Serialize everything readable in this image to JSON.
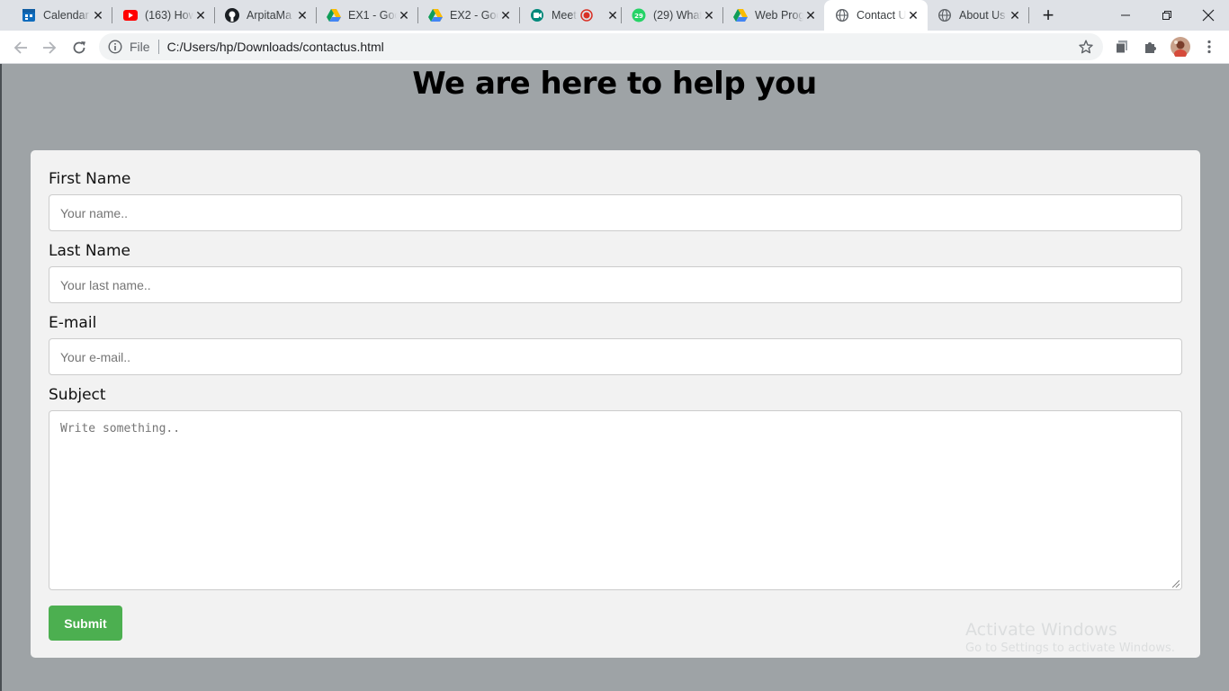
{
  "browser": {
    "tabs": [
      {
        "title": "Calendar",
        "icon": "calendar-icon",
        "active": false
      },
      {
        "title": "(163) How",
        "icon": "youtube-icon",
        "active": false
      },
      {
        "title": "ArpitaMa",
        "icon": "github-icon",
        "active": false
      },
      {
        "title": "EX1 - Goo",
        "icon": "google-drive-icon",
        "active": false
      },
      {
        "title": "EX2 - Goo",
        "icon": "google-drive-icon",
        "active": false
      },
      {
        "title": "Meet",
        "icon": "google-meet-icon",
        "active": false
      },
      {
        "title": "(29) What",
        "icon": "whatsapp-icon",
        "active": false
      },
      {
        "title": "Web Prog",
        "icon": "google-drive-icon",
        "active": false
      },
      {
        "title": "Contact U",
        "icon": "globe-icon",
        "active": true
      },
      {
        "title": "About Us",
        "icon": "globe-icon",
        "active": false
      }
    ],
    "address": {
      "scheme_label": "File",
      "url": "C:/Users/hp/Downloads/contactus.html"
    },
    "whatsapp_badge": "29"
  },
  "page": {
    "heading": "We are here to help you",
    "form": {
      "first_name": {
        "label": "First Name",
        "placeholder": "Your name.."
      },
      "last_name": {
        "label": "Last Name",
        "placeholder": "Your last name.."
      },
      "email": {
        "label": "E-mail",
        "placeholder": "Your e-mail.."
      },
      "subject": {
        "label": "Subject",
        "placeholder": "Write something.."
      },
      "submit_label": "Submit"
    }
  },
  "watermark": {
    "line1": "Activate Windows",
    "line2": "Go to Settings to activate Windows."
  },
  "colors": {
    "page_bg": "#9ea3a6",
    "card_bg": "#f2f2f2",
    "submit_bg": "#4caf50",
    "tabstrip_bg": "#dee1e6"
  }
}
